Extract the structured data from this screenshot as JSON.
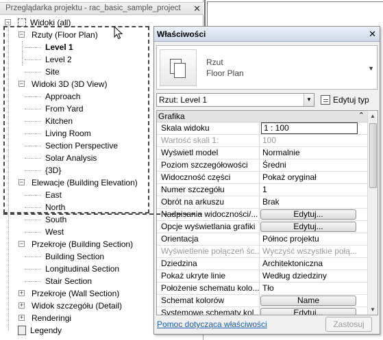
{
  "browser": {
    "title": "Przeglądarka projektu - rac_basic_sample_project",
    "close": "✕",
    "tree": [
      {
        "id": "views",
        "label": "Widoki (all)",
        "level": 0,
        "exp": "−"
      },
      {
        "id": "floor",
        "label": "Rzuty (Floor Plan)",
        "level": 1,
        "exp": "−"
      },
      {
        "id": "lvl1",
        "label": "Level 1",
        "level": 2,
        "selected": true
      },
      {
        "id": "lvl2",
        "label": "Level 2",
        "level": 2
      },
      {
        "id": "site",
        "label": "Site",
        "level": 2
      },
      {
        "id": "v3d",
        "label": "Widoki 3D (3D View)",
        "level": 1,
        "exp": "−"
      },
      {
        "id": "approach",
        "label": "Approach",
        "level": 2
      },
      {
        "id": "yard",
        "label": "From Yard",
        "level": 2
      },
      {
        "id": "kitchen",
        "label": "Kitchen",
        "level": 2
      },
      {
        "id": "living",
        "label": "Living Room",
        "level": 2
      },
      {
        "id": "secpersp",
        "label": "Section Perspective",
        "level": 2
      },
      {
        "id": "solar",
        "label": "Solar Analysis",
        "level": 2
      },
      {
        "id": "d3",
        "label": "{3D}",
        "level": 2
      },
      {
        "id": "elev",
        "label": "Elewacje (Building Elevation)",
        "level": 1,
        "exp": "−"
      },
      {
        "id": "east",
        "label": "East",
        "level": 2
      },
      {
        "id": "north",
        "label": "North",
        "level": 2
      },
      {
        "id": "south",
        "label": "South",
        "level": 2
      },
      {
        "id": "west",
        "label": "West",
        "level": 2
      },
      {
        "id": "bsec",
        "label": "Przekroje (Building Section)",
        "level": 1,
        "exp": "−"
      },
      {
        "id": "bs1",
        "label": "Building Section",
        "level": 2
      },
      {
        "id": "bs2",
        "label": "Longitudinal Section",
        "level": 2
      },
      {
        "id": "bs3",
        "label": "Stair Section",
        "level": 2
      },
      {
        "id": "wsec",
        "label": "Przekroje (Wall Section)",
        "level": 1,
        "exp": "+"
      },
      {
        "id": "detail",
        "label": "Widok szczegółu (Detail)",
        "level": 1,
        "exp": "+"
      },
      {
        "id": "render",
        "label": "Renderingi",
        "level": 1,
        "exp": "+"
      },
      {
        "id": "legend",
        "label": "Legendy",
        "level": 0,
        "exp": ""
      }
    ]
  },
  "props": {
    "title": "Właściwości",
    "close": "✕",
    "type_line1": "Rzut",
    "type_line2": "Floor Plan",
    "selector_value": "Rzut: Level 1",
    "edit_type_label": "Edytuj typ",
    "group_label": "Grafika",
    "rows": [
      {
        "key": "Skala widoku",
        "value": "1 : 100",
        "kind": "input"
      },
      {
        "key": "Wartość skali   1:",
        "value": "100",
        "kind": "disabled"
      },
      {
        "key": "Wyświetl model",
        "value": "Normalnie",
        "kind": "text"
      },
      {
        "key": "Poziom szczegółowości",
        "value": "Średni",
        "kind": "text"
      },
      {
        "key": "Widoczność części",
        "value": "Pokaż oryginał",
        "kind": "text"
      },
      {
        "key": "Numer szczegółu",
        "value": "1",
        "kind": "text"
      },
      {
        "key": "Obrót na arkuszu",
        "value": "Brak",
        "kind": "text"
      },
      {
        "key": "Nadpisania widoczności/...",
        "value": "Edytuj...",
        "kind": "button"
      },
      {
        "key": "Opcje wyświetlania grafiki",
        "value": "Edytuj...",
        "kind": "button"
      },
      {
        "key": "Orientacja",
        "value": "Północ projektu",
        "kind": "text"
      },
      {
        "key": "Wyświetlenie połączeń śc...",
        "value": "Wyczyść wszystkie połą...",
        "kind": "disabled"
      },
      {
        "key": "Dziedzina",
        "value": "Architektoniczna",
        "kind": "text"
      },
      {
        "key": "Pokaż ukryte linie",
        "value": "Według dziedziny",
        "kind": "text"
      },
      {
        "key": "Położenie schematu kolo...",
        "value": "Tło",
        "kind": "text"
      },
      {
        "key": "Schemat kolorów",
        "value": "Name",
        "kind": "button"
      },
      {
        "key": "Systemowe schematy kol...",
        "value": "Edytuj...",
        "kind": "button"
      }
    ],
    "help_link": "Pomoc dotycząca właściwości",
    "apply_label": "Zastosuj"
  },
  "icons": {
    "collapse": "⌃",
    "dropdown": "▼",
    "more": "▸"
  }
}
